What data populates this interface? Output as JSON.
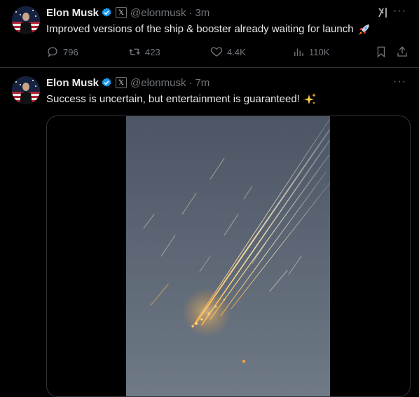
{
  "tweets": [
    {
      "author": {
        "name": "Elon Musk",
        "handle": "@elonmusk",
        "time": "3m"
      },
      "text": "Improved versions of the ship & booster already waiting for launch",
      "emoji": "rocket-emoji",
      "stats": {
        "replies": "796",
        "reposts": "423",
        "likes": "4.4K",
        "views": "110K"
      }
    },
    {
      "author": {
        "name": "Elon Musk",
        "handle": "@elonmusk",
        "time": "7m"
      },
      "text": "Success is uncertain, but entertainment is guaranteed!",
      "emoji": "sparkles-emoji"
    }
  ],
  "ui": {
    "separator": "·",
    "more": "···",
    "x_badge": "𝕏"
  },
  "colors": {
    "background": "#000000",
    "text": "#e7e9ea",
    "muted": "#71767b",
    "verified": "#1d9bf0",
    "border": "#2f3336"
  }
}
